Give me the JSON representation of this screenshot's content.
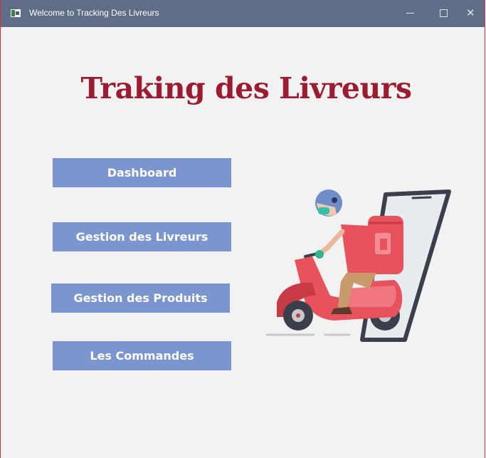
{
  "window": {
    "title": "Welcome to Tracking Des Livreurs",
    "controls": {
      "minimize": "—",
      "maximize": "☐",
      "close": "✕"
    }
  },
  "main": {
    "headline": "Traking des Livreurs",
    "buttons": [
      {
        "label": "Dashboard"
      },
      {
        "label": "Gestion des Livreurs"
      },
      {
        "label": "Gestion des Produits"
      },
      {
        "label": "Les Commandes"
      }
    ],
    "illustration": "delivery-scooter-phone-illustration"
  },
  "colors": {
    "titlebar": "#5f6e86",
    "headline": "#9b1c31",
    "button": "#7b96cf",
    "background": "#f2f2f2",
    "scooter": "#e8525d"
  }
}
